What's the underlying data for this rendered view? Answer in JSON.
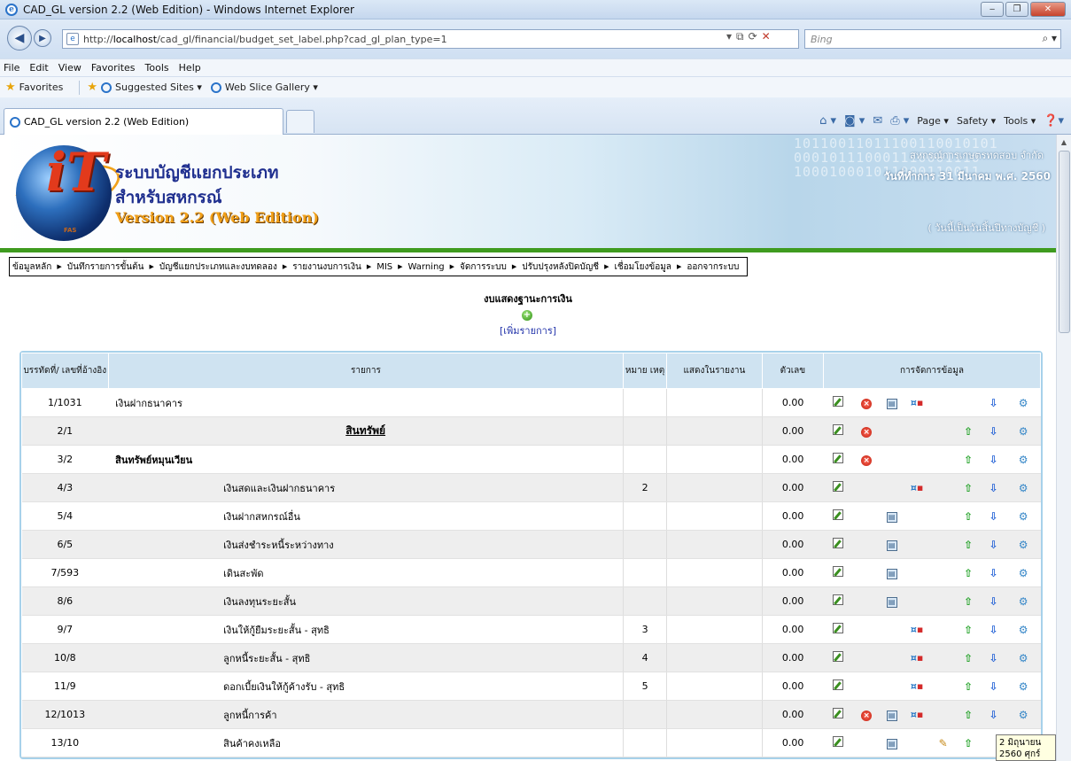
{
  "window": {
    "title": "CAD_GL version 2.2 (Web Edition) - Windows Internet Explorer",
    "min": "‒",
    "max": "❐",
    "close": "✕"
  },
  "address": {
    "url_prefix": "http://",
    "url_host": "localhost",
    "url_path": "/cad_gl/financial/budget_set_label.php?cad_gl_plan_type=1",
    "search_placeholder": "Bing"
  },
  "menubar": [
    "File",
    "Edit",
    "View",
    "Favorites",
    "Tools",
    "Help"
  ],
  "favbar": {
    "favorites": "Favorites",
    "suggested": "Suggested Sites ▾",
    "webslice": "Web Slice Gallery ▾"
  },
  "tab": {
    "title": "CAD_GL version 2.2 (Web Edition)"
  },
  "cmdbar": {
    "page": "Page ▾",
    "safety": "Safety ▾",
    "tools": "Tools ▾"
  },
  "banner": {
    "title": "ระบบบัญชีแยกประเภท",
    "subtitle": "สำหรับสหกรณ์",
    "version": "Version 2.2 (Web Edition)",
    "coop_name": "สหกรณ์การเกษตรทดสอบ จำกัด",
    "work_date": "วันที่ทำการ 31 มีนาคม พ.ศ. 2560",
    "fiscal_note": "( วันนี้เป็นวันสิ้นปีทางบัญชี )"
  },
  "mainmenu": [
    "ข้อมูลหลัก",
    "บันทึกรายการขั้นต้น",
    "บัญชีแยกประเภทและงบทดลอง",
    "รายงานงบการเงิน",
    "MIS",
    "Warning",
    "จัดการระบบ",
    "ปรับปรุงหลังปิดบัญชี",
    "เชื่อมโยงข้อมูล",
    "ออกจากระบบ"
  ],
  "page": {
    "report_title": "งบแสดงฐานะการเงิน",
    "add_link": "[เพิ่มรายการ]"
  },
  "table": {
    "headers": {
      "line_ref": "บรรทัดที่/ เลขที่อ้างอิง",
      "item": "รายการ",
      "note": "หมาย เหตุ",
      "show": "แสดงในรายงาน",
      "amount": "ตัวเลข",
      "manage": "การจัดการข้อมูล"
    },
    "rows": [
      {
        "ref": "1/1031",
        "name": "เงินฝากธนาคาร",
        "note": "",
        "amount": "0.00"
      },
      {
        "ref": "2/1",
        "name": "สินทรัพย์",
        "note": "",
        "amount": "0.00"
      },
      {
        "ref": "3/2",
        "name": "สินทรัพย์หมุนเวียน",
        "note": "",
        "amount": "0.00"
      },
      {
        "ref": "4/3",
        "name": "เงินสดและเงินฝากธนาคาร",
        "note": "2",
        "amount": "0.00"
      },
      {
        "ref": "5/4",
        "name": "เงินฝากสหกรณ์อื่น",
        "note": "",
        "amount": "0.00"
      },
      {
        "ref": "6/5",
        "name": "เงินส่งชำระหนี้ระหว่างทาง",
        "note": "",
        "amount": "0.00"
      },
      {
        "ref": "7/593",
        "name": "เดินสะพัด",
        "note": "",
        "amount": "0.00"
      },
      {
        "ref": "8/6",
        "name": "เงินลงทุนระยะสั้น",
        "note": "",
        "amount": "0.00"
      },
      {
        "ref": "9/7",
        "name": "เงินให้กู้ยืมระยะสั้น - สุทธิ",
        "note": "3",
        "amount": "0.00"
      },
      {
        "ref": "10/8",
        "name": "ลูกหนี้ระยะสั้น - สุทธิ",
        "note": "4",
        "amount": "0.00"
      },
      {
        "ref": "11/9",
        "name": "ดอกเบี้ยเงินให้กู้ค้างรับ - สุทธิ",
        "note": "5",
        "amount": "0.00"
      },
      {
        "ref": "12/1013",
        "name": "ลูกหนี้การค้า",
        "note": "",
        "amount": "0.00"
      },
      {
        "ref": "13/10",
        "name": "สินค้าคงเหลือ",
        "note": "",
        "amount": "0.00"
      }
    ]
  },
  "tooltip": "2 มิถุนายน 2560 ศุกร์"
}
